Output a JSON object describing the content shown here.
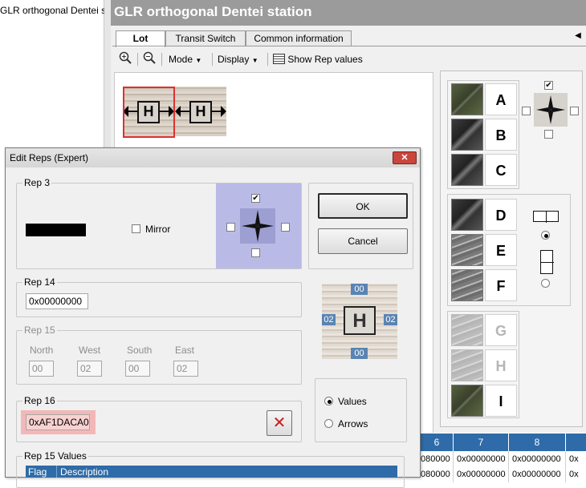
{
  "tree": {
    "item": "GLR orthogonal Dentei station"
  },
  "window": {
    "title": "GLR orthogonal Dentei station"
  },
  "tabs": [
    {
      "label": "Lot"
    },
    {
      "label": "Transit Switch"
    },
    {
      "label": "Common information"
    }
  ],
  "toolbar": {
    "mode": "Mode",
    "display": "Display",
    "show_rep": "Show Rep values"
  },
  "canvas": {
    "tile_letter": "H"
  },
  "palette": {
    "group1": [
      "A",
      "B",
      "C"
    ],
    "group2": [
      "D",
      "E",
      "F"
    ],
    "group3": [
      "G",
      "H",
      "I"
    ]
  },
  "table": {
    "headers": [
      "6",
      "7",
      "8"
    ],
    "row": [
      "080000",
      "0x00000000",
      "0x00000000",
      "0x"
    ],
    "row2": [
      "080000",
      "0x00000000",
      "0x00000000",
      "0x"
    ]
  },
  "dialog": {
    "title": "Edit Reps (Expert)",
    "rep3": {
      "legend": "Rep 3",
      "mirror": "Mirror"
    },
    "ok": "OK",
    "cancel": "Cancel",
    "rep14": {
      "legend": "Rep 14",
      "value": "0x00000000"
    },
    "rep15": {
      "legend": "Rep 15",
      "north": "North",
      "west": "West",
      "south": "South",
      "east": "East",
      "north_val": "00",
      "west_val": "02",
      "south_val": "00",
      "east_val": "02"
    },
    "preview": {
      "top": "00",
      "left": "02",
      "right": "02",
      "bottom": "00",
      "letter": "H"
    },
    "rep16": {
      "legend": "Rep 16",
      "value": "0xAF1DACA0"
    },
    "mode": {
      "values": "Values",
      "arrows": "Arrows"
    },
    "rep15_values": {
      "legend": "Rep 15 Values",
      "col_flag": "Flag",
      "col_desc": "Description"
    }
  }
}
